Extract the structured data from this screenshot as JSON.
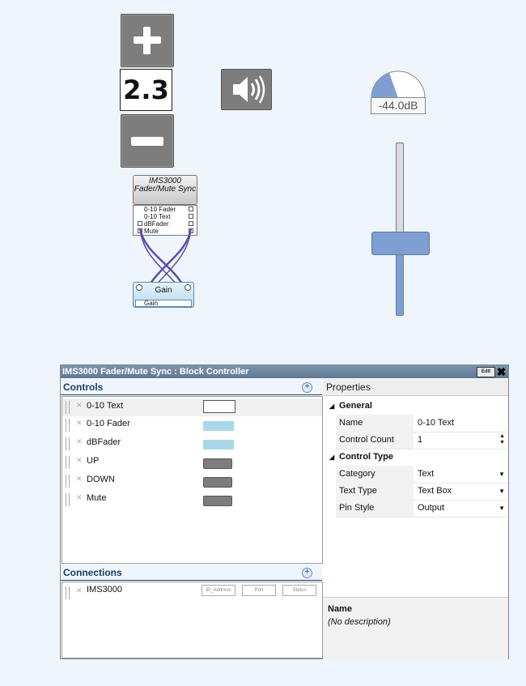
{
  "stepper": {
    "value": "2.3"
  },
  "meter": {
    "level_db": "-44.0dB"
  },
  "fader": {
    "level_fraction": 0.35
  },
  "block": {
    "title": "IMS3000 Fader/Mute Sync",
    "pins": [
      "0-10 Fader",
      "0-10 Text",
      "dBFader",
      "Mute"
    ],
    "gain_title": "Gain",
    "gain_pin": "Gain"
  },
  "panel": {
    "title": "IMS3000 Fader/Mute Sync : Block Controller",
    "edit_label": "Edit",
    "close_label": "✖",
    "controls_heading": "Controls",
    "controls": [
      {
        "label": "0-10 Text",
        "preview": "text"
      },
      {
        "label": "0-10 Fader",
        "preview": "fader"
      },
      {
        "label": "dBFader",
        "preview": "fader"
      },
      {
        "label": "UP",
        "preview": "button"
      },
      {
        "label": "DOWN",
        "preview": "button"
      },
      {
        "label": "Mute",
        "preview": "button"
      }
    ],
    "connections_heading": "Connections",
    "connections": [
      {
        "label": "IMS3000",
        "fields": [
          "IP_Address",
          "Port",
          "Status"
        ]
      }
    ],
    "properties_heading": "Properties",
    "general_category": "General",
    "control_type_category": "Control Type",
    "props_general": [
      {
        "name": "Name",
        "value": "0-10 Text"
      },
      {
        "name": "Control Count",
        "value": "1"
      }
    ],
    "props_type": [
      {
        "name": "Category",
        "value": "Text"
      },
      {
        "name": "Text Type",
        "value": "Text Box"
      },
      {
        "name": "Pin Style",
        "value": "Output"
      }
    ],
    "desc_title": "Name",
    "desc_text": "(No description)"
  }
}
